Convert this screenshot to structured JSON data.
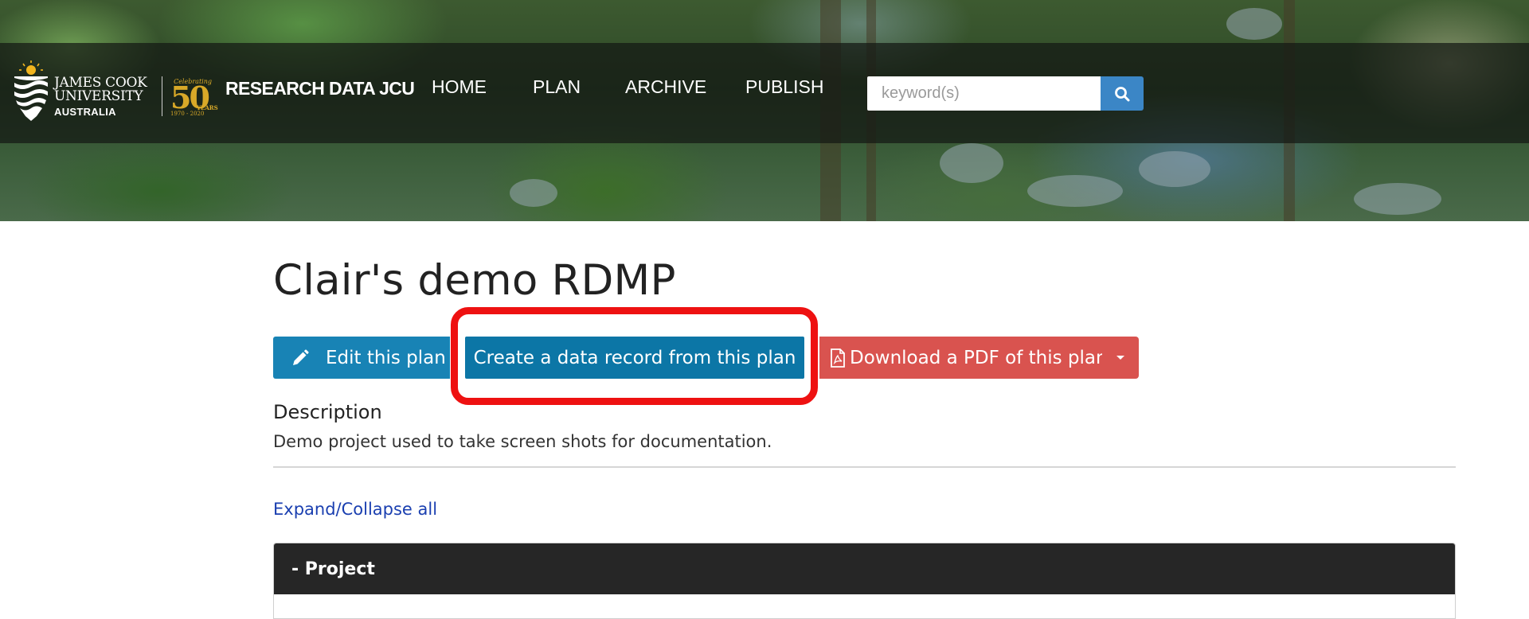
{
  "header": {
    "logo": {
      "line1": "JAMES COOK",
      "line2": "UNIVERSITY",
      "country": "AUSTRALIA",
      "celebrating": "Celebrating",
      "fifty": "50",
      "years": "YEARS",
      "range": "1970 - 2020"
    },
    "site_name": "RESEARCH DATA JCU",
    "nav": [
      "HOME",
      "PLAN",
      "ARCHIVE",
      "PUBLISH"
    ],
    "search": {
      "placeholder": "keyword(s)",
      "value": "",
      "button_icon": "search-icon"
    }
  },
  "main": {
    "title": "Clair's demo RDMP",
    "actions": {
      "edit": "Edit this plan",
      "create": "Create a data record from this plan",
      "pdf": "Download a PDF of this plan",
      "dropdown_icon": "caret-down-icon"
    },
    "description_label": "Description",
    "description_text": "Demo project used to take screen shots for documentation.",
    "expand_collapse": "Expand/Collapse all",
    "panel": {
      "title": "- Project"
    }
  },
  "colors": {
    "primary": "#1883b5",
    "create_button": "#0c76a6",
    "danger": "#d9534f",
    "highlight": "#ee1111",
    "search_button": "#3b86c6",
    "panel_header": "#262626",
    "link": "#1a3fb0",
    "logo_gold": "#d8a928"
  }
}
